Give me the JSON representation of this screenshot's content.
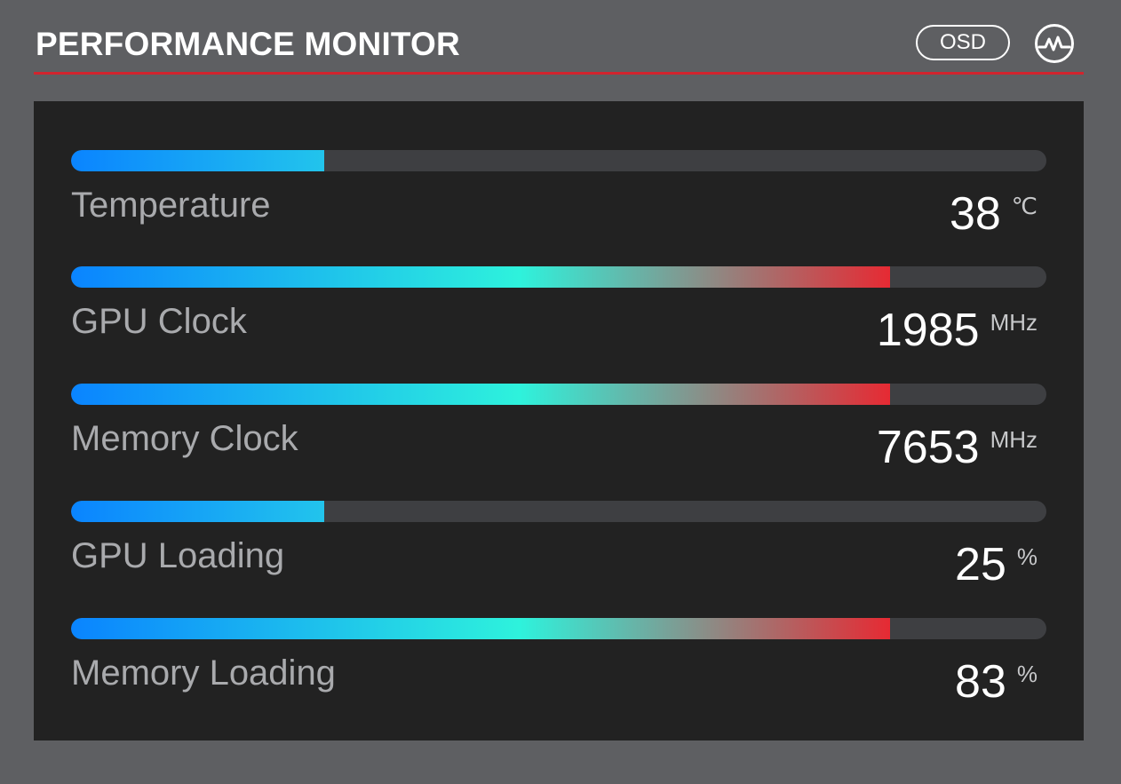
{
  "header": {
    "title": "PERFORMANCE MONITOR",
    "osd_label": "OSD",
    "monitor_icon": "heartbeat-icon"
  },
  "colors": {
    "accent": "#d1242e",
    "bar_start": "#0a84ff",
    "bar_mid": "#2ef2dc",
    "bar_end": "#e62a33",
    "track": "#3e3f42"
  },
  "metrics": [
    {
      "label": "Temperature",
      "value": "38",
      "unit": "℃",
      "fill_fraction": 0.26
    },
    {
      "label": "GPU Clock",
      "value": "1985",
      "unit": "MHz",
      "fill_fraction": 0.84
    },
    {
      "label": "Memory Clock",
      "value": "7653",
      "unit": "MHz",
      "fill_fraction": 0.84
    },
    {
      "label": "GPU Loading",
      "value": "25",
      "unit": "%",
      "fill_fraction": 0.26
    },
    {
      "label": "Memory Loading",
      "value": "83",
      "unit": "%",
      "fill_fraction": 0.84
    }
  ]
}
